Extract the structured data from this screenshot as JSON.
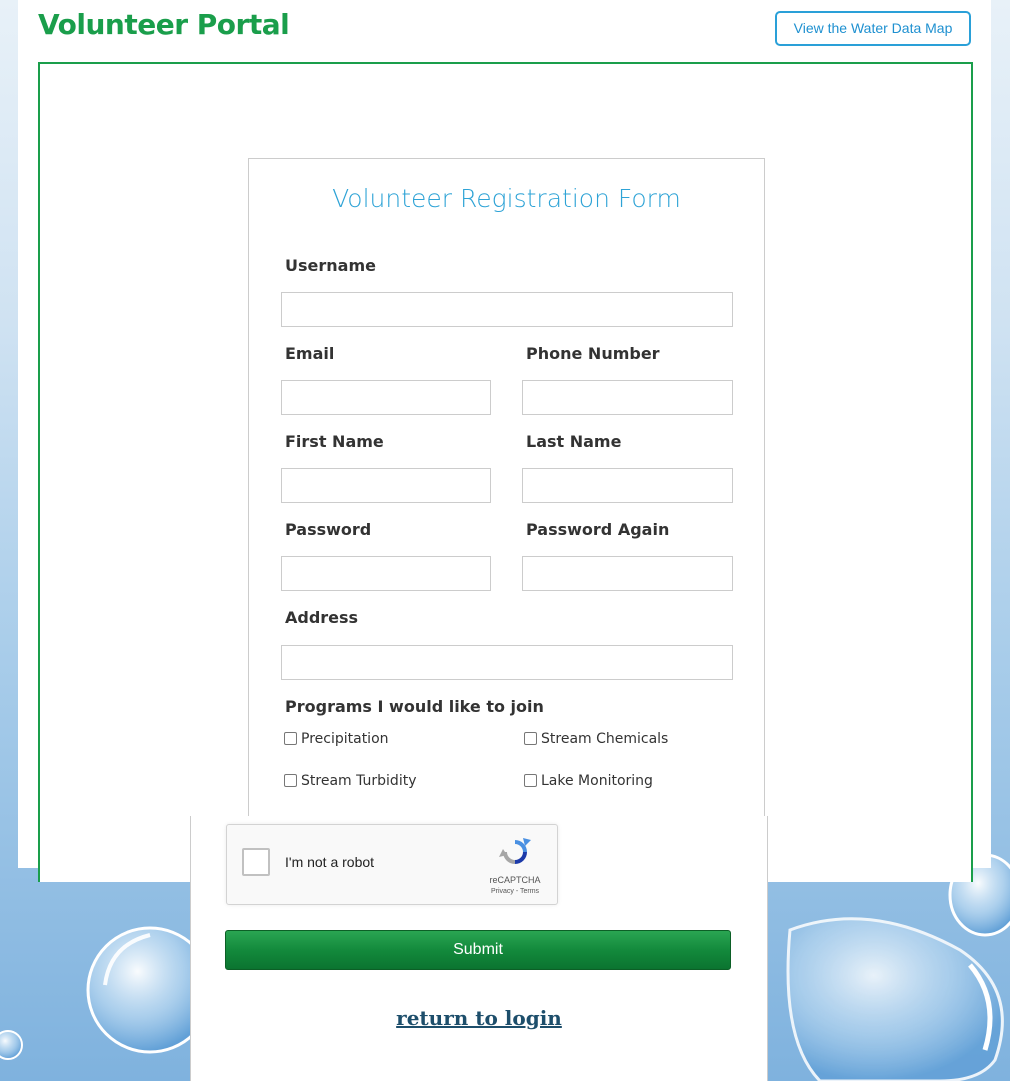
{
  "header": {
    "portal_title": "Volunteer Portal",
    "map_button_label": "View the Water Data Map"
  },
  "form": {
    "title": "Volunteer Registration Form",
    "fields": {
      "username": {
        "label": "Username",
        "value": ""
      },
      "email": {
        "label": "Email",
        "value": ""
      },
      "phone": {
        "label": "Phone Number",
        "value": ""
      },
      "first_name": {
        "label": "First Name",
        "value": ""
      },
      "last_name": {
        "label": "Last Name",
        "value": ""
      },
      "password": {
        "label": "Password",
        "value": ""
      },
      "password_again": {
        "label": "Password Again",
        "value": ""
      },
      "address": {
        "label": "Address",
        "value": ""
      }
    },
    "programs": {
      "label": "Programs I would like to join",
      "options": [
        {
          "label": "Precipitation",
          "checked": false
        },
        {
          "label": "Stream Chemicals",
          "checked": false
        },
        {
          "label": "Stream Turbidity",
          "checked": false
        },
        {
          "label": "Lake Monitoring",
          "checked": false
        }
      ]
    },
    "captcha": {
      "label": "I'm not a robot",
      "brand": "reCAPTCHA",
      "links": "Privacy - Terms",
      "icon": "recaptcha-icon"
    },
    "submit_label": "Submit",
    "return_link": "return to login"
  },
  "colors": {
    "brand_green": "#1a9e4b",
    "accent_blue": "#2ea3d6",
    "button_green": "#138a3c",
    "link_color": "#1d4e6b"
  }
}
